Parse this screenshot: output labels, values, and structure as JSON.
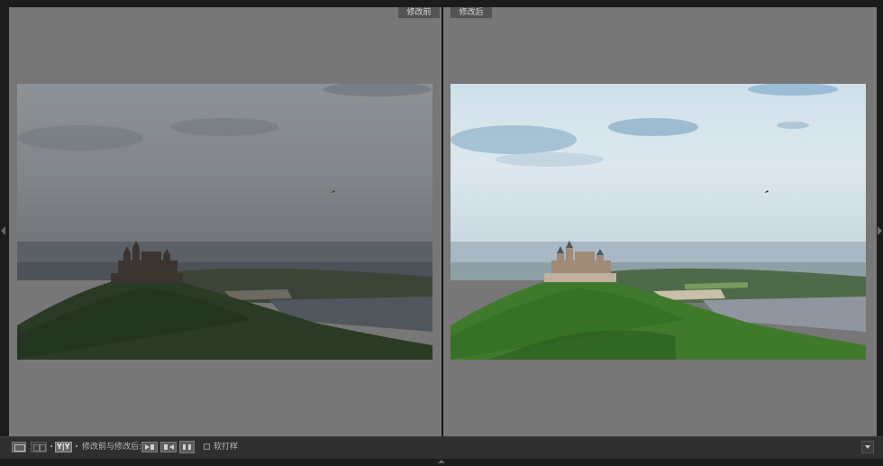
{
  "panes": {
    "before_label": "修改前",
    "after_label": "修改后"
  },
  "toolbar": {
    "view_loupe_icon": "single-view-icon",
    "view_grid_icon": "grid-view-icon",
    "view_compare_icon": "before-after-view-icon",
    "view_compare_label": "Y|Y",
    "mode_label": "修改前与修改后:",
    "copy_before_to_after_icon": "copy-before-to-after-icon",
    "copy_after_to_before_icon": "copy-after-to-before-icon",
    "swap_icon": "swap-before-after-icon",
    "soft_proof_label": "软打样",
    "soft_proof_checked": false,
    "menu_icon": "toolbar-menu-chevron-icon"
  },
  "colors": {
    "pane_bg": "#777777",
    "toolbar_bg": "#2f2f2f",
    "label_bg": "#545454"
  }
}
